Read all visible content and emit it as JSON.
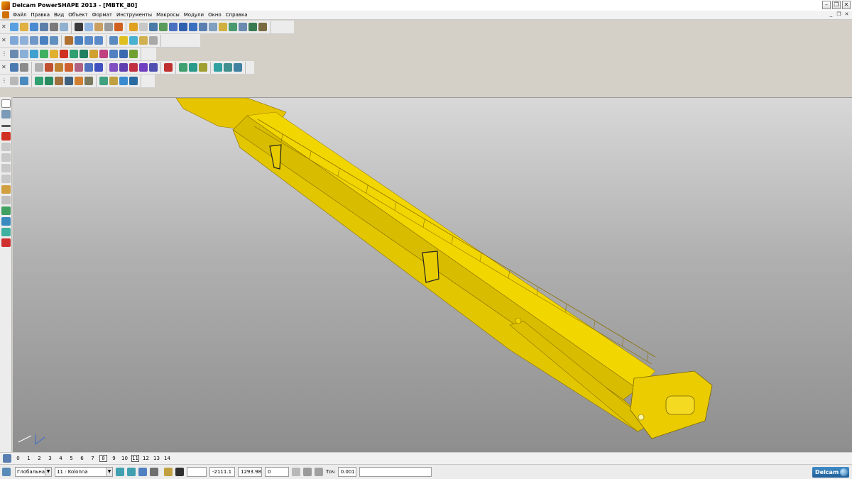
{
  "window": {
    "title": "Delcam PowerSHAPE 2013 - [MBTK_80]",
    "minimize_icon": "minimize-icon",
    "maximize_icon": "restore-icon",
    "close_icon": "close-icon"
  },
  "menu": {
    "items": [
      "Файл",
      "Правка",
      "Вид",
      "Объект",
      "Формат",
      "Инструменты",
      "Макросы",
      "Модули",
      "Окно",
      "Справка"
    ]
  },
  "levels": {
    "items": [
      "0",
      "1",
      "2",
      "3",
      "4",
      "5",
      "6",
      "7",
      "8",
      "9",
      "10",
      "11",
      "12",
      "13",
      "14"
    ],
    "boxed": [
      "8",
      "11"
    ]
  },
  "status": {
    "workplane": "Глобальна",
    "level": "11 : Kolonna",
    "x": "-2111.1",
    "y": "1293.98",
    "z": "0",
    "tolerance_label": "Точ",
    "tolerance_value": "0.001",
    "message": ""
  },
  "brand": {
    "logo_text": "Delcam"
  },
  "colors": {
    "model_yellow": "#f0d000",
    "accent": "#1f5e96"
  }
}
